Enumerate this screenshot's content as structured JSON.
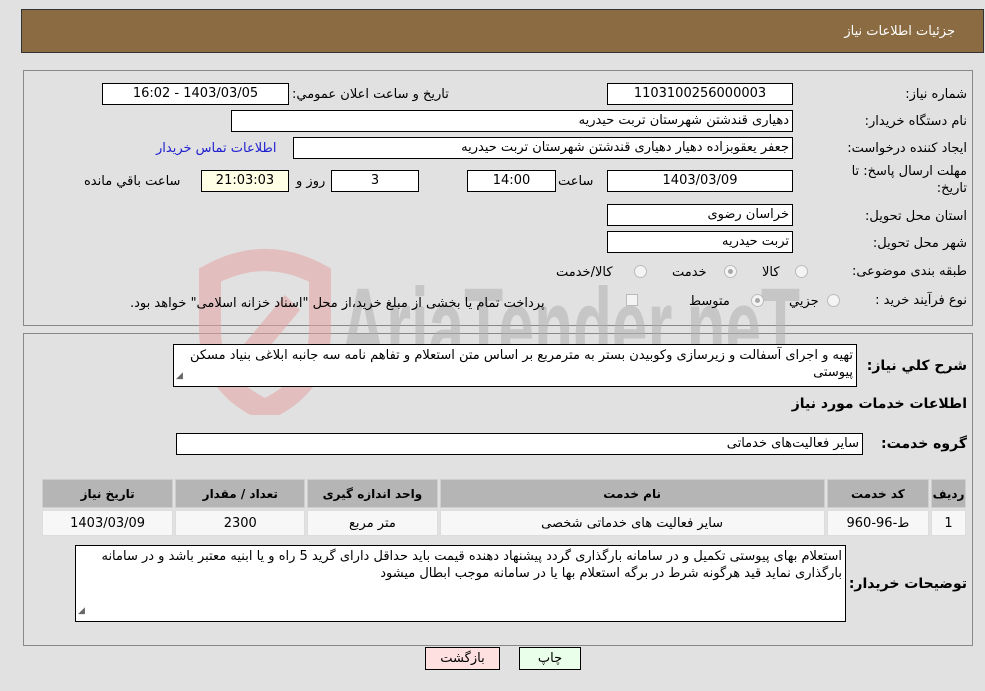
{
  "header": {
    "title": "جزئیات اطلاعات نیاز"
  },
  "fields": {
    "need_number_label": "شماره نیاز:",
    "need_number": "1103100256000003",
    "announce_label": "تاریخ و ساعت اعلان عمومي:",
    "announce_value": "1403/03/05 - 16:02",
    "buyer_org_label": "نام دستگاه خريدار:",
    "buyer_org": "دهیاری قندشتن  شهرستان تربت حیدریه",
    "creator_label": "ايجاد کننده درخواست:",
    "creator": "جعفر یعقوبزاده دهیار دهیاری قندشتن  شهرستان تربت حیدریه",
    "contact_link": "اطلاعات تماس خريدار",
    "deadline_label_1": "مهلت ارسال پاسخ: تا",
    "deadline_label_2": "تاريخ:",
    "deadline_date": "1403/03/09",
    "time_label": "ساعت",
    "deadline_time": "14:00",
    "days_value": "3",
    "days_label": "روز و",
    "remaining_time": "21:03:03",
    "remaining_label": "ساعت باقي مانده",
    "province_label": "استان محل تحويل:",
    "province": "خراسان رضوی",
    "city_label": "شهر محل تحويل:",
    "city": "تربت حیدریه",
    "category_label": "طبقه بندی موضوعی:",
    "category_options": [
      {
        "label": "کالا",
        "checked": false
      },
      {
        "label": "خدمت",
        "checked": true
      },
      {
        "label": "کالا/خدمت",
        "checked": false
      }
    ],
    "process_label": "نوع فرآيند خريد :",
    "process_options": [
      {
        "label": "جزيي",
        "checked": false
      },
      {
        "label": "متوسط",
        "checked": true
      }
    ],
    "treasury_note": "پرداخت تمام يا بخشی از مبلغ خريد،از محل \"اسناد خزانه اسلامی\" خواهد بود.",
    "treasury_checked": false
  },
  "description": {
    "label": "شرح كلي نياز:",
    "text": "تهیه و اجرای آسفالت و زیرسازی وکوبیدن بستر به مترمربع بر اساس متن استعلام و تفاهم نامه سه جانبه ابلاغی بنیاد مسکن پیوستی"
  },
  "services": {
    "section_title": "اطلاعات خدمات مورد نياز",
    "group_label": "گروه خدمت:",
    "group_value": "سایر فعالیت‌های خدماتی",
    "columns": [
      "رديف",
      "کد خدمت",
      "نام خدمت",
      "واحد اندازه گيری",
      "تعداد / مقدار",
      "تاريخ نياز"
    ],
    "rows": [
      [
        "1",
        "ط-96-960",
        "سایر فعالیت های خدماتی شخصی",
        "متر مربع",
        "2300",
        "1403/03/09"
      ]
    ]
  },
  "buyer_notes": {
    "label": "توضيحات خريدار:",
    "text": "استعلام بهای پیوستی تکمیل و در سامانه بارگذاری گردد پیشنهاد دهنده قیمت باید حداقل دارای گرید 5 راه و یا ابنیه معتبر باشد و در سامانه بارگذاری نماید قید هرگونه شرط در برگه استعلام بها یا در سامانه موجب ابطال میشود"
  },
  "buttons": {
    "print": "چاپ",
    "back": "بازگشت"
  },
  "watermark": {
    "text": "AriaTender.neT"
  },
  "colors": {
    "header_bg": "#8b6b42",
    "print_bg": "#eaffea",
    "back_bg": "#ffe0e0",
    "link": "#2020d0"
  }
}
